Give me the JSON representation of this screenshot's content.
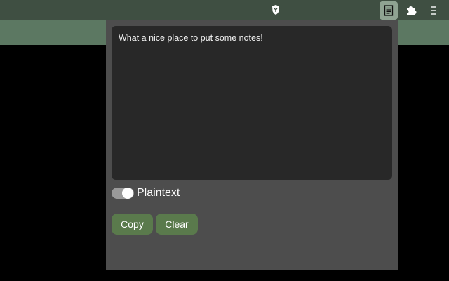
{
  "popup": {
    "notes_text": "What a nice place to put some notes!",
    "plaintext_label": "Plaintext",
    "plaintext_enabled": true,
    "copy_label": "Copy",
    "clear_label": "Clear"
  },
  "toolbar": {
    "shield_icon": "brave-shield-icon",
    "notes_extension_icon": "notes-icon",
    "extensions_icon": "puzzle-icon",
    "menu_icon": "hamburger-menu-icon"
  },
  "colors": {
    "toolbar_bg": "#3f4f42",
    "bookmark_bar_bg": "#5c7862",
    "popup_bg": "#4d4d4d",
    "textarea_bg": "#282828",
    "button_bg": "#5a7a4c"
  }
}
